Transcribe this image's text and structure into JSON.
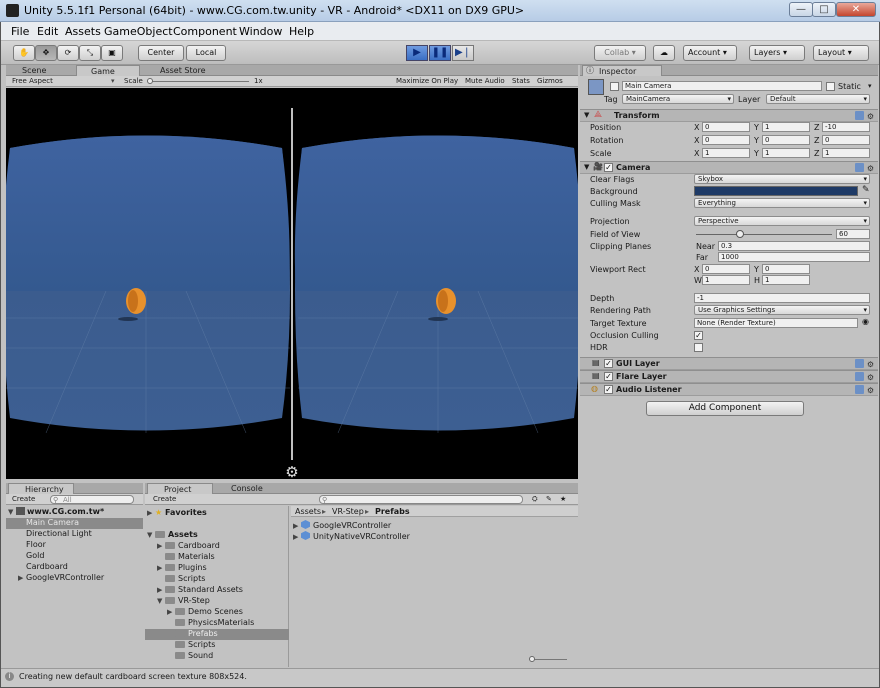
{
  "window": {
    "title": "Unity 5.5.1f1 Personal (64bit) - www.CG.com.tw.unity - VR - Android* <DX11 on DX9 GPU>",
    "minimize": "—",
    "maximize": "□",
    "close": "✕"
  },
  "menu": [
    "File",
    "Edit",
    "Assets",
    "GameObject",
    "Component",
    "Window",
    "Help"
  ],
  "toolbar": {
    "pivot_center": "Center",
    "pivot_space": "Local",
    "collab": "Collab ▾",
    "account": "Account",
    "layers": "Layers",
    "layout": "Layout"
  },
  "scene_tabs": [
    "Scene",
    "Game",
    "Asset Store"
  ],
  "game_bar": {
    "aspect": "Free Aspect",
    "scale_label": "Scale",
    "scale_value": "1x",
    "maximize": "Maximize On Play",
    "mute": "Mute Audio",
    "stats": "Stats",
    "gizmos": "Gizmos"
  },
  "hierarchy": {
    "tab": "Hierarchy",
    "create": "Create",
    "search_placeholder": "All",
    "scene": "www.CG.com.tw*",
    "items": [
      "Main Camera",
      "Directional Light",
      "Floor",
      "Gold",
      "Cardboard",
      "GoogleVRController"
    ]
  },
  "project": {
    "tab": "Project",
    "console_tab": "Console",
    "create": "Create",
    "favorites": "Favorites",
    "assets": "Assets",
    "folders": [
      "Cardboard",
      "Materials",
      "Plugins",
      "Scripts",
      "Standard Assets",
      "VR-Step",
      "Demo Scenes",
      "PhysicsMaterials",
      "Prefabs",
      "Scripts",
      "Sound"
    ],
    "breadcrumb": [
      "Assets",
      "VR-Step",
      "Prefabs"
    ],
    "files": [
      "GoogleVRController",
      "UnityNativeVRController"
    ]
  },
  "inspector": {
    "tab": "Inspector",
    "object_name": "Main Camera",
    "static": "Static",
    "tag_label": "Tag",
    "tag": "MainCamera",
    "layer_label": "Layer",
    "layer": "Default",
    "transform": {
      "title": "Transform",
      "position": {
        "label": "Position",
        "x": "0",
        "y": "1",
        "z": "-10"
      },
      "rotation": {
        "label": "Rotation",
        "x": "0",
        "y": "0",
        "z": "0"
      },
      "scale": {
        "label": "Scale",
        "x": "1",
        "y": "1",
        "z": "1"
      }
    },
    "camera": {
      "title": "Camera",
      "clear_flags_label": "Clear Flags",
      "clear_flags": "Skybox",
      "background_label": "Background",
      "culling_mask_label": "Culling Mask",
      "culling_mask": "Everything",
      "projection_label": "Projection",
      "projection": "Perspective",
      "fov_label": "Field of View",
      "fov": "60",
      "clipping_label": "Clipping Planes",
      "near_label": "Near",
      "near": "0.3",
      "far_label": "Far",
      "far": "1000",
      "viewport_label": "Viewport Rect",
      "vx": "0",
      "vy": "0",
      "vw": "1",
      "vh": "1",
      "depth_label": "Depth",
      "depth": "-1",
      "rendering_path_label": "Rendering Path",
      "rendering_path": "Use Graphics Settings",
      "target_texture_label": "Target Texture",
      "target_texture": "None (Render Texture)",
      "occlusion_label": "Occlusion Culling",
      "hdr_label": "HDR"
    },
    "gui_layer": "GUI Layer",
    "flare_layer": "Flare Layer",
    "audio_listener": "Audio Listener",
    "add_component": "Add Component"
  },
  "status": "Creating new default cardboard screen texture 808x524.",
  "colors": {
    "sky": "#3d5f96",
    "ground": "#3a5a88",
    "gold": "#e8912c",
    "background_swatch": "#1e3a66"
  }
}
